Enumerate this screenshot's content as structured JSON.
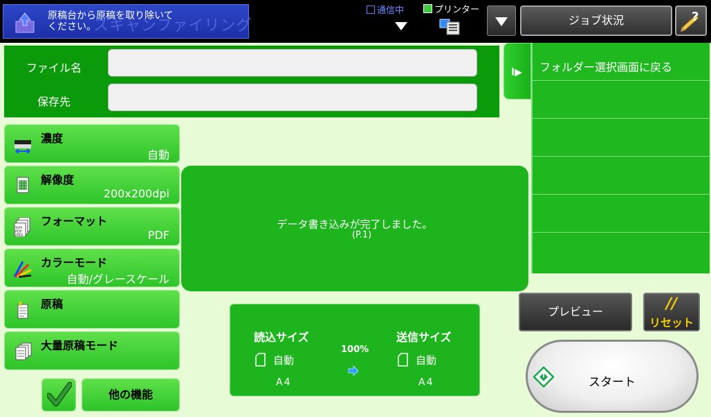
{
  "header": {
    "background_title": "スキャンファイリング",
    "message": "原稿台から原稿を取り除いて\nください。",
    "communication_status": "通信中",
    "printer_label": "プリンター",
    "job_status_label": "ジョブ状況"
  },
  "file_panel": {
    "file_name_label": "ファイル名",
    "file_name_value": "",
    "save_to_label": "保存先",
    "save_to_value": ""
  },
  "folder_panel": {
    "back_label": "フォルダー選択画面に戻る"
  },
  "settings": [
    {
      "label": "濃度",
      "value": "自動",
      "icon": "density-icon"
    },
    {
      "label": "解像度",
      "value": "200x200dpi",
      "icon": "resolution-icon"
    },
    {
      "label": "フォーマット",
      "value": "PDF",
      "icon": "format-icon"
    },
    {
      "label": "カラーモード",
      "value": "自動/グレースケール",
      "icon": "color-mode-icon"
    },
    {
      "label": "原稿",
      "value": "",
      "icon": "original-icon"
    },
    {
      "label": "大量原稿モード",
      "value": "",
      "icon": "job-build-icon"
    }
  ],
  "status": {
    "message": "データ書き込みが完了しました。",
    "page": "(P.1)"
  },
  "size": {
    "scan_label": "読込サイズ",
    "scan_mode": "自動",
    "scan_paper": "A4",
    "ratio": "100%",
    "send_label": "送信サイズ",
    "send_mode": "自動",
    "send_paper": "A4"
  },
  "actions": {
    "preview_label": "プレビュー",
    "reset_label": "リセット",
    "start_label": "スタート",
    "other_functions_label": "他の機能"
  },
  "colors": {
    "topbar": "#000000",
    "panel_green": "#0a9a0a",
    "button_green": "#2ec42a",
    "background": "#e6fbd6",
    "reset_yellow": "#f4d000"
  }
}
